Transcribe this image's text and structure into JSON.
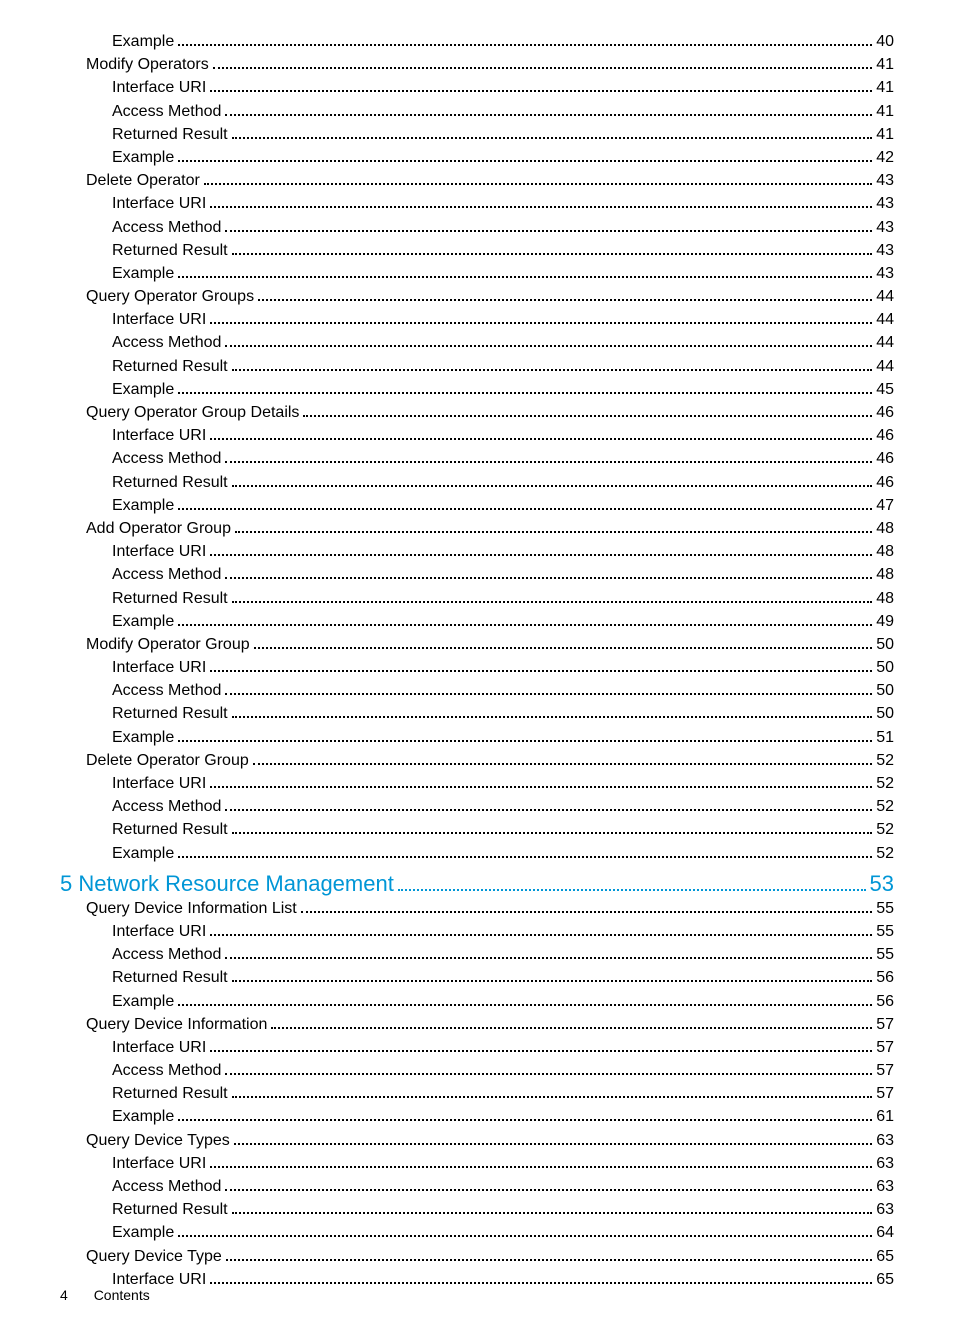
{
  "toc": [
    {
      "level": 3,
      "label": "Example",
      "page": "40"
    },
    {
      "level": 2,
      "label": "Modify Operators",
      "page": "41"
    },
    {
      "level": 3,
      "label": "Interface URI",
      "page": "41"
    },
    {
      "level": 3,
      "label": "Access Method",
      "page": "41"
    },
    {
      "level": 3,
      "label": "Returned Result",
      "page": "41"
    },
    {
      "level": 3,
      "label": "Example",
      "page": "42"
    },
    {
      "level": 2,
      "label": "Delete Operator",
      "page": "43"
    },
    {
      "level": 3,
      "label": "Interface URI",
      "page": "43"
    },
    {
      "level": 3,
      "label": "Access Method",
      "page": "43"
    },
    {
      "level": 3,
      "label": "Returned Result",
      "page": "43"
    },
    {
      "level": 3,
      "label": "Example",
      "page": "43"
    },
    {
      "level": 2,
      "label": "Query Operator Groups",
      "page": "44"
    },
    {
      "level": 3,
      "label": "Interface URI",
      "page": "44"
    },
    {
      "level": 3,
      "label": "Access Method",
      "page": "44"
    },
    {
      "level": 3,
      "label": "Returned Result",
      "page": "44"
    },
    {
      "level": 3,
      "label": "Example",
      "page": "45"
    },
    {
      "level": 2,
      "label": "Query Operator Group Details",
      "page": "46"
    },
    {
      "level": 3,
      "label": "Interface URI",
      "page": "46"
    },
    {
      "level": 3,
      "label": "Access Method",
      "page": "46"
    },
    {
      "level": 3,
      "label": "Returned Result",
      "page": "46"
    },
    {
      "level": 3,
      "label": "Example",
      "page": "47"
    },
    {
      "level": 2,
      "label": "Add Operator Group",
      "page": "48"
    },
    {
      "level": 3,
      "label": "Interface URI",
      "page": "48"
    },
    {
      "level": 3,
      "label": "Access Method",
      "page": "48"
    },
    {
      "level": 3,
      "label": "Returned Result",
      "page": "48"
    },
    {
      "level": 3,
      "label": "Example",
      "page": "49"
    },
    {
      "level": 2,
      "label": "Modify Operator Group",
      "page": "50"
    },
    {
      "level": 3,
      "label": "Interface URI",
      "page": "50"
    },
    {
      "level": 3,
      "label": "Access Method",
      "page": "50"
    },
    {
      "level": 3,
      "label": "Returned Result",
      "page": "50"
    },
    {
      "level": 3,
      "label": "Example",
      "page": "51"
    },
    {
      "level": 2,
      "label": "Delete Operator Group",
      "page": "52"
    },
    {
      "level": 3,
      "label": "Interface URI",
      "page": "52"
    },
    {
      "level": 3,
      "label": "Access Method",
      "page": "52"
    },
    {
      "level": 3,
      "label": "Returned Result",
      "page": "52"
    },
    {
      "level": 3,
      "label": "Example",
      "page": "52"
    },
    {
      "level": 1,
      "label": "5 Network Resource Management",
      "page": "53"
    },
    {
      "level": 2,
      "label": "Query Device Information List",
      "page": "55"
    },
    {
      "level": 3,
      "label": "Interface URI",
      "page": "55"
    },
    {
      "level": 3,
      "label": "Access Method",
      "page": "55"
    },
    {
      "level": 3,
      "label": "Returned Result",
      "page": "56"
    },
    {
      "level": 3,
      "label": "Example",
      "page": "56"
    },
    {
      "level": 2,
      "label": "Query Device Information",
      "page": "57"
    },
    {
      "level": 3,
      "label": "Interface URI",
      "page": "57"
    },
    {
      "level": 3,
      "label": "Access Method",
      "page": "57"
    },
    {
      "level": 3,
      "label": "Returned Result",
      "page": "57"
    },
    {
      "level": 3,
      "label": "Example",
      "page": "61"
    },
    {
      "level": 2,
      "label": "Query Device Types",
      "page": "63"
    },
    {
      "level": 3,
      "label": "Interface URI",
      "page": "63"
    },
    {
      "level": 3,
      "label": "Access Method",
      "page": "63"
    },
    {
      "level": 3,
      "label": "Returned Result",
      "page": "63"
    },
    {
      "level": 3,
      "label": "Example",
      "page": "64"
    },
    {
      "level": 2,
      "label": "Query Device Type",
      "page": "65"
    },
    {
      "level": 3,
      "label": "Interface URI",
      "page": "65"
    }
  ],
  "footer": {
    "page_number": "4",
    "section": "Contents"
  }
}
